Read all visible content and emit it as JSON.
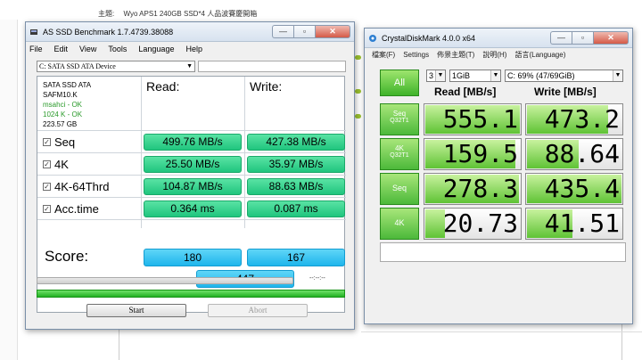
{
  "background": {
    "topline_label": "主題:",
    "topline_text": "Wyo APS1 240GB SSD*4 人品波賽慶開箱"
  },
  "asssd": {
    "title": "AS SSD Benchmark 1.7.4739.38088",
    "controls": {
      "minimize": "—",
      "maximize": "▫",
      "close": "✕"
    },
    "menu": [
      "File",
      "Edit",
      "View",
      "Tools",
      "Language",
      "Help"
    ],
    "drive_select": "C: SATA SSD ATA Device",
    "info": {
      "model": "SATA SSD ATA",
      "firmware": "SAFM10.K",
      "driver": "msahci - OK",
      "alignment": "1024 K - OK",
      "size": "223.57 GB"
    },
    "headers": {
      "read": "Read:",
      "write": "Write:"
    },
    "rows": [
      {
        "label": "Seq",
        "read": "499.76 MB/s",
        "write": "427.38 MB/s"
      },
      {
        "label": "4K",
        "read": "25.50 MB/s",
        "write": "35.97 MB/s"
      },
      {
        "label": "4K-64Thrd",
        "read": "104.87 MB/s",
        "write": "88.63 MB/s"
      },
      {
        "label": "Acc.time",
        "read": "0.364 ms",
        "write": "0.087 ms"
      }
    ],
    "check_mark": "✓",
    "score_label": "Score:",
    "score_read": "180",
    "score_write": "167",
    "score_total": "447",
    "time": "--:--:--",
    "start_label": "Start",
    "abort_label": "Abort"
  },
  "cdm": {
    "title": "CrystalDiskMark 4.0.0 x64",
    "controls": {
      "minimize": "—",
      "maximize": "▫",
      "close": "✕"
    },
    "menu": [
      "檔案(F)",
      "Settings",
      "佈景主題(T)",
      "說明(H)",
      "語言(Language)"
    ],
    "all_label": "All",
    "count_select": "3",
    "size_select": "1GiB",
    "drive_select": "C: 69% (47/69GiB)",
    "read_head": "Read [MB/s]",
    "write_head": "Write [MB/s]",
    "rows": [
      {
        "label1": "Seq",
        "label2": "Q32T1",
        "read": "555.1",
        "write": "473.2",
        "read_fill": 1.0,
        "write_fill": 0.86
      },
      {
        "label1": "4K",
        "label2": "Q32T1",
        "read": "159.5",
        "write": "88.64",
        "read_fill": 0.95,
        "write_fill": 0.55
      },
      {
        "label1": "Seq",
        "label2": "",
        "read": "278.3",
        "write": "435.4",
        "read_fill": 0.99,
        "write_fill": 1.0
      },
      {
        "label1": "4K",
        "label2": "",
        "read": "20.73",
        "write": "41.51",
        "read_fill": 0.21,
        "write_fill": 0.48
      }
    ]
  }
}
